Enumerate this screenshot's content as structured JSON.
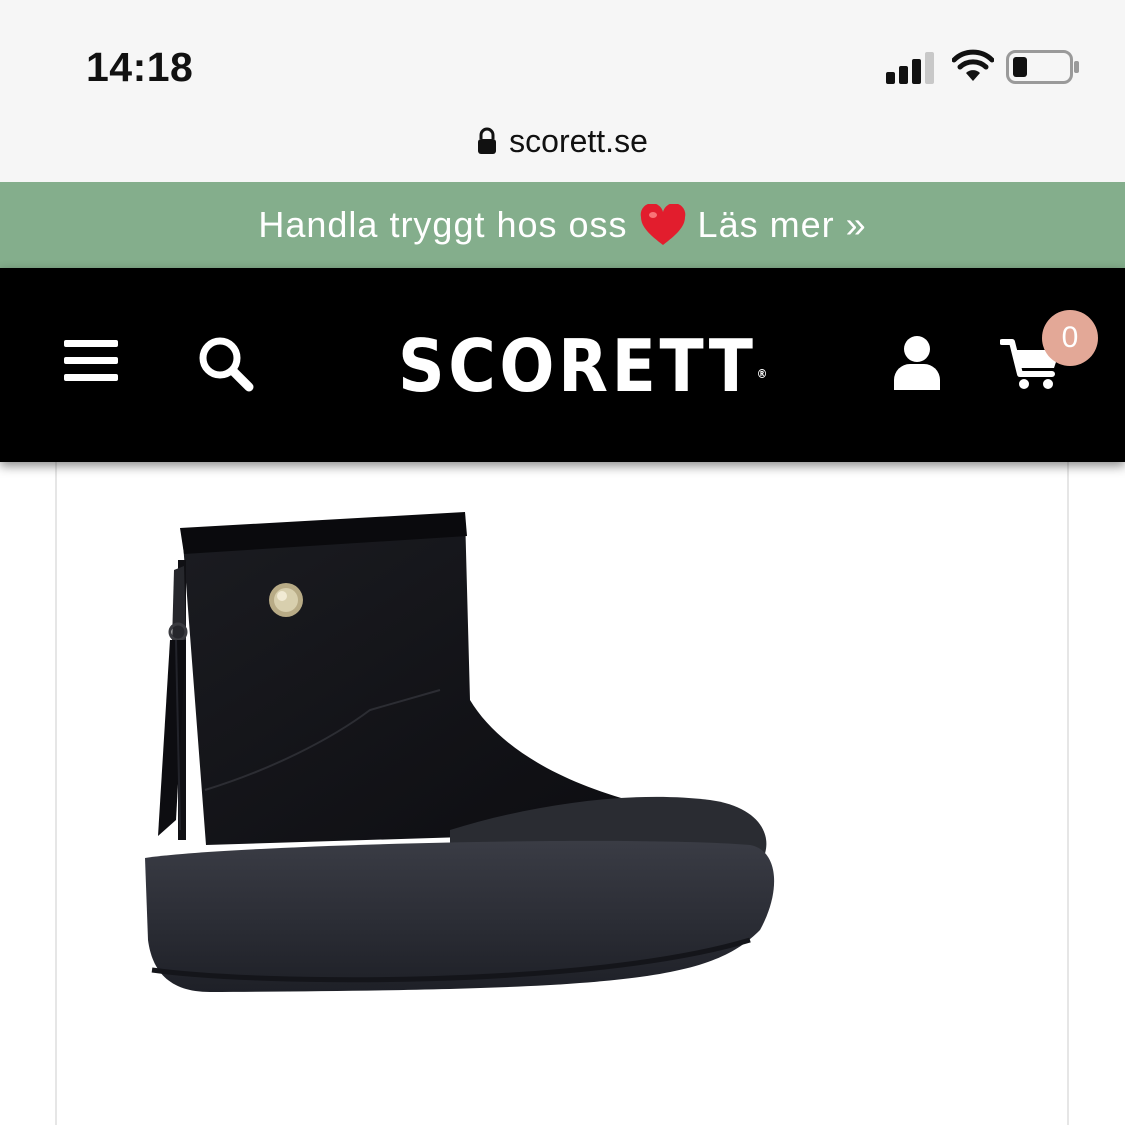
{
  "status_bar": {
    "time": "14:18",
    "icons": [
      "signal-icon",
      "wifi-icon",
      "battery-icon"
    ]
  },
  "browser": {
    "url": "scorett.se",
    "lock_icon": "lock-icon"
  },
  "promo_banner": {
    "text_before": "Handla tryggt hos oss",
    "heart_icon": "heart-icon",
    "link_text": "Läs mer »",
    "background": "#84ae8c"
  },
  "header": {
    "menu_icon": "hamburger-menu-icon",
    "search_icon": "search-icon",
    "logo_text": "SCORETT",
    "logo_mark": "®",
    "account_icon": "user-icon",
    "cart_icon": "cart-icon",
    "cart_count": "0",
    "badge_color": "#e3a897"
  },
  "product": {
    "image": "black-suede-ankle-boot"
  }
}
